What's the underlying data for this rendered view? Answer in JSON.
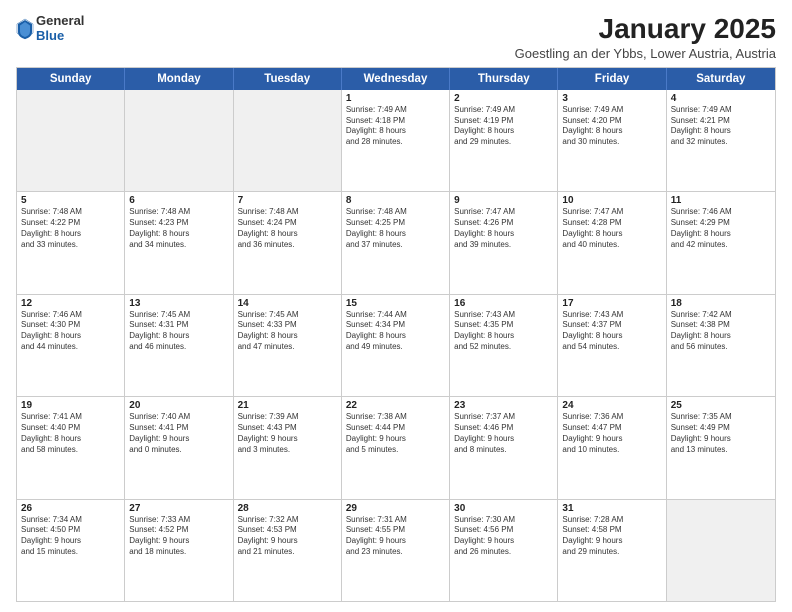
{
  "logo": {
    "general": "General",
    "blue": "Blue"
  },
  "header": {
    "title": "January 2025",
    "subtitle": "Goestling an der Ybbs, Lower Austria, Austria"
  },
  "weekdays": [
    "Sunday",
    "Monday",
    "Tuesday",
    "Wednesday",
    "Thursday",
    "Friday",
    "Saturday"
  ],
  "rows": [
    [
      {
        "day": "",
        "text": "",
        "shaded": true
      },
      {
        "day": "",
        "text": "",
        "shaded": true
      },
      {
        "day": "",
        "text": "",
        "shaded": true
      },
      {
        "day": "1",
        "text": "Sunrise: 7:49 AM\nSunset: 4:18 PM\nDaylight: 8 hours\nand 28 minutes."
      },
      {
        "day": "2",
        "text": "Sunrise: 7:49 AM\nSunset: 4:19 PM\nDaylight: 8 hours\nand 29 minutes."
      },
      {
        "day": "3",
        "text": "Sunrise: 7:49 AM\nSunset: 4:20 PM\nDaylight: 8 hours\nand 30 minutes."
      },
      {
        "day": "4",
        "text": "Sunrise: 7:49 AM\nSunset: 4:21 PM\nDaylight: 8 hours\nand 32 minutes."
      }
    ],
    [
      {
        "day": "5",
        "text": "Sunrise: 7:48 AM\nSunset: 4:22 PM\nDaylight: 8 hours\nand 33 minutes."
      },
      {
        "day": "6",
        "text": "Sunrise: 7:48 AM\nSunset: 4:23 PM\nDaylight: 8 hours\nand 34 minutes."
      },
      {
        "day": "7",
        "text": "Sunrise: 7:48 AM\nSunset: 4:24 PM\nDaylight: 8 hours\nand 36 minutes."
      },
      {
        "day": "8",
        "text": "Sunrise: 7:48 AM\nSunset: 4:25 PM\nDaylight: 8 hours\nand 37 minutes."
      },
      {
        "day": "9",
        "text": "Sunrise: 7:47 AM\nSunset: 4:26 PM\nDaylight: 8 hours\nand 39 minutes."
      },
      {
        "day": "10",
        "text": "Sunrise: 7:47 AM\nSunset: 4:28 PM\nDaylight: 8 hours\nand 40 minutes."
      },
      {
        "day": "11",
        "text": "Sunrise: 7:46 AM\nSunset: 4:29 PM\nDaylight: 8 hours\nand 42 minutes."
      }
    ],
    [
      {
        "day": "12",
        "text": "Sunrise: 7:46 AM\nSunset: 4:30 PM\nDaylight: 8 hours\nand 44 minutes."
      },
      {
        "day": "13",
        "text": "Sunrise: 7:45 AM\nSunset: 4:31 PM\nDaylight: 8 hours\nand 46 minutes."
      },
      {
        "day": "14",
        "text": "Sunrise: 7:45 AM\nSunset: 4:33 PM\nDaylight: 8 hours\nand 47 minutes."
      },
      {
        "day": "15",
        "text": "Sunrise: 7:44 AM\nSunset: 4:34 PM\nDaylight: 8 hours\nand 49 minutes."
      },
      {
        "day": "16",
        "text": "Sunrise: 7:43 AM\nSunset: 4:35 PM\nDaylight: 8 hours\nand 52 minutes."
      },
      {
        "day": "17",
        "text": "Sunrise: 7:43 AM\nSunset: 4:37 PM\nDaylight: 8 hours\nand 54 minutes."
      },
      {
        "day": "18",
        "text": "Sunrise: 7:42 AM\nSunset: 4:38 PM\nDaylight: 8 hours\nand 56 minutes."
      }
    ],
    [
      {
        "day": "19",
        "text": "Sunrise: 7:41 AM\nSunset: 4:40 PM\nDaylight: 8 hours\nand 58 minutes."
      },
      {
        "day": "20",
        "text": "Sunrise: 7:40 AM\nSunset: 4:41 PM\nDaylight: 9 hours\nand 0 minutes."
      },
      {
        "day": "21",
        "text": "Sunrise: 7:39 AM\nSunset: 4:43 PM\nDaylight: 9 hours\nand 3 minutes."
      },
      {
        "day": "22",
        "text": "Sunrise: 7:38 AM\nSunset: 4:44 PM\nDaylight: 9 hours\nand 5 minutes."
      },
      {
        "day": "23",
        "text": "Sunrise: 7:37 AM\nSunset: 4:46 PM\nDaylight: 9 hours\nand 8 minutes."
      },
      {
        "day": "24",
        "text": "Sunrise: 7:36 AM\nSunset: 4:47 PM\nDaylight: 9 hours\nand 10 minutes."
      },
      {
        "day": "25",
        "text": "Sunrise: 7:35 AM\nSunset: 4:49 PM\nDaylight: 9 hours\nand 13 minutes."
      }
    ],
    [
      {
        "day": "26",
        "text": "Sunrise: 7:34 AM\nSunset: 4:50 PM\nDaylight: 9 hours\nand 15 minutes."
      },
      {
        "day": "27",
        "text": "Sunrise: 7:33 AM\nSunset: 4:52 PM\nDaylight: 9 hours\nand 18 minutes."
      },
      {
        "day": "28",
        "text": "Sunrise: 7:32 AM\nSunset: 4:53 PM\nDaylight: 9 hours\nand 21 minutes."
      },
      {
        "day": "29",
        "text": "Sunrise: 7:31 AM\nSunset: 4:55 PM\nDaylight: 9 hours\nand 23 minutes."
      },
      {
        "day": "30",
        "text": "Sunrise: 7:30 AM\nSunset: 4:56 PM\nDaylight: 9 hours\nand 26 minutes."
      },
      {
        "day": "31",
        "text": "Sunrise: 7:28 AM\nSunset: 4:58 PM\nDaylight: 9 hours\nand 29 minutes."
      },
      {
        "day": "",
        "text": "",
        "shaded": true
      }
    ]
  ]
}
